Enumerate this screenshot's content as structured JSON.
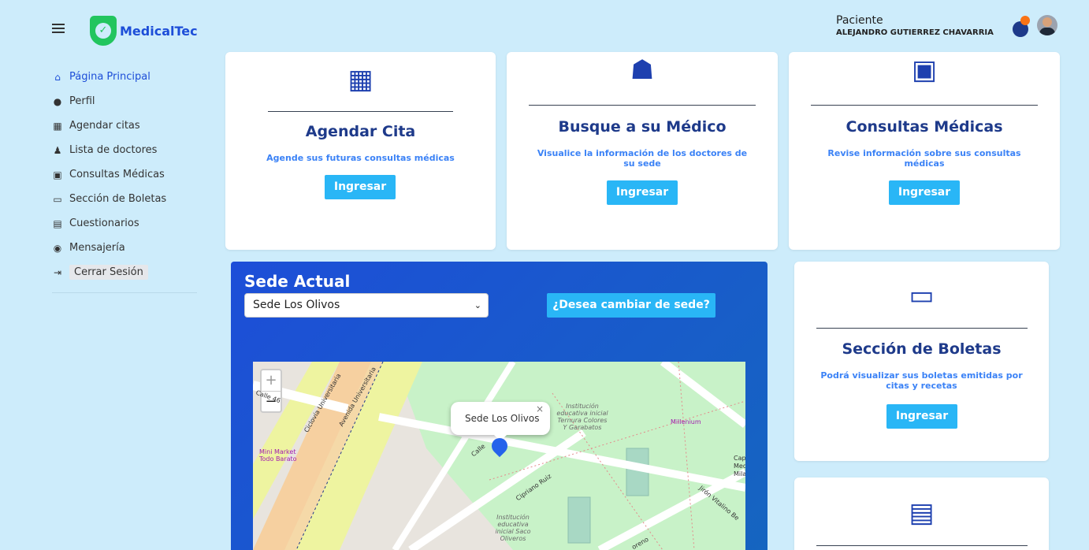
{
  "header": {
    "brand": "MedicalTec",
    "role": "Paciente",
    "user_name": "ALEJANDRO GUTIERREZ CHAVARRIA"
  },
  "sidebar": {
    "items": [
      {
        "label": "Página Principal",
        "icon": "home-icon",
        "active": true
      },
      {
        "label": "Perfil",
        "icon": "user-icon",
        "active": false
      },
      {
        "label": "Agendar citas",
        "icon": "hospital-icon",
        "active": false
      },
      {
        "label": "Lista de doctores",
        "icon": "doctor-icon",
        "active": false
      },
      {
        "label": "Consultas Médicas",
        "icon": "address-book-icon",
        "active": false
      },
      {
        "label": "Sección de Boletas",
        "icon": "credit-card-icon",
        "active": false
      },
      {
        "label": "Cuestionarios",
        "icon": "file-icon",
        "active": false
      },
      {
        "label": "Mensajería",
        "icon": "messenger-icon",
        "active": false
      }
    ],
    "logout_label": "Cerrar Sesión"
  },
  "cards": {
    "agendar": {
      "title": "Agendar Cita",
      "desc": "Agende sus futuras consultas médicas",
      "button": "Ingresar",
      "icon": "hospital-icon"
    },
    "medico": {
      "title": "Busque a su Médico",
      "desc": "Visualice la información de los doctores de su sede",
      "button": "Ingresar",
      "icon": "user-doctor-icon"
    },
    "consultas": {
      "title": "Consultas Médicas",
      "desc": "Revise información sobre sus consultas médicas",
      "button": "Ingresar",
      "icon": "address-book-icon"
    },
    "boletas": {
      "title": "Sección de Boletas",
      "desc": "Podrá visualizar sus boletas emitidas por citas y recetas",
      "button": "Ingresar",
      "icon": "credit-card-icon"
    },
    "cuestionarios": {
      "icon": "file-lines-icon"
    }
  },
  "sede": {
    "title": "Sede Actual",
    "selected": "Sede Los Olivos",
    "change_button": "¿Desea cambiar de sede?"
  },
  "map": {
    "zoom_in": "+",
    "zoom_out": "−",
    "popup": "Sede Los Olivos",
    "labels": {
      "institucion1": "Institución educativa inicial Ternura Colores Y Garabatos",
      "institucion2": "Institución educativa inicial Saco Oliveros",
      "millenium": "Millenium",
      "minimarket": "Mini Market Todo Barato",
      "capilla": "Capill Medal Milagr",
      "calle46": "Calle 46",
      "ciclovia": "Ciclovía Universitaria",
      "avenida": "Avenida Universitaria",
      "cipriano": "Cipriano Ruiz",
      "jiron": "Jirón Vitalino Be",
      "calle": "Calle",
      "moreno": "oreno"
    }
  },
  "colors": {
    "background": "#cdecfb",
    "primary_blue": "#1e3a8a",
    "button_blue": "#29b6f6",
    "brand_green": "#22c55e"
  }
}
